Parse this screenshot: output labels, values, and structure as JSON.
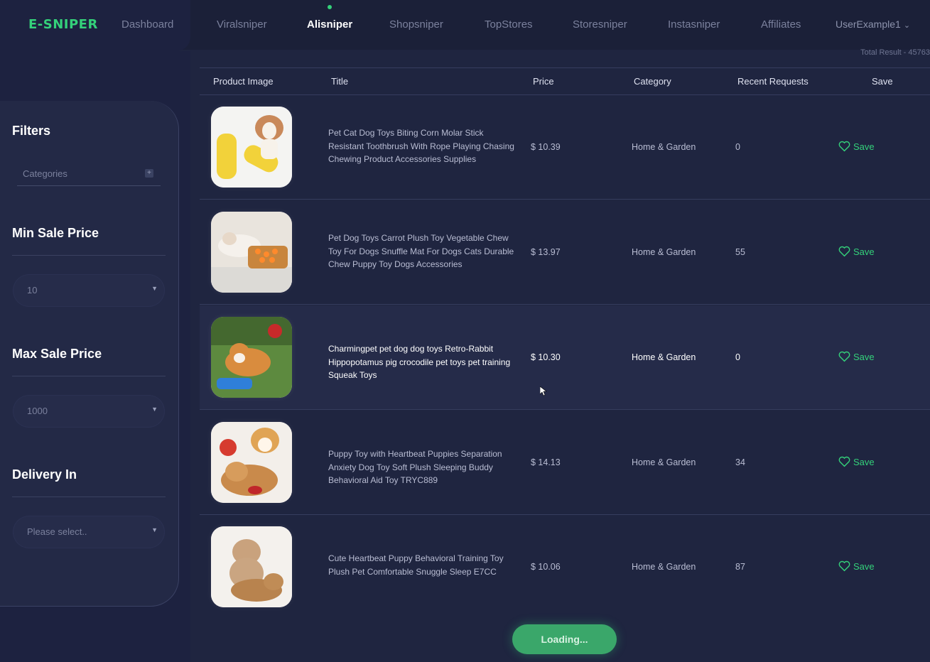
{
  "app": {
    "logo": "E-SNIPER"
  },
  "nav": {
    "items": [
      "Dashboard",
      "Viralsniper",
      "Alisniper",
      "Shopsniper",
      "TopStores",
      "Storesniper",
      "Instasniper",
      "Affiliates"
    ],
    "active": "Alisniper",
    "user": "UserExample1"
  },
  "sidebar": {
    "filters_heading": "Filters",
    "categories_label": "Categories",
    "min_sale_price": {
      "heading": "Min Sale Price",
      "value": "10"
    },
    "max_sale_price": {
      "heading": "Max Sale Price",
      "value": "1000"
    },
    "delivery_in": {
      "heading": "Delivery In",
      "placeholder": "Please select.."
    }
  },
  "table": {
    "total_result": "Total Result - 45763",
    "columns": [
      "Product Image",
      "Title",
      "Price",
      "Category",
      "Recent Requests",
      "Save"
    ],
    "rows": [
      {
        "title": "Pet Cat Dog Toys Biting Corn Molar Stick Resistant Toothbrush With Rope Playing Chasing Chewing Product Accessories Supplies",
        "price": "$ 10.39",
        "category": "Home & Garden",
        "requests": "0",
        "save": "Save"
      },
      {
        "title": "Pet Dog Toys Carrot Plush Toy Vegetable Chew Toy For Dogs Snuffle Mat For Dogs Cats Durable Chew Puppy Toy Dogs Accessories",
        "price": "$ 13.97",
        "category": "Home & Garden",
        "requests": "55",
        "save": "Save"
      },
      {
        "title": "Charmingpet pet dog dog toys Retro-Rabbit Hippopotamus pig crocodile pet toys pet training Squeak Toys",
        "price": "$ 10.30",
        "category": "Home & Garden",
        "requests": "0",
        "save": "Save"
      },
      {
        "title": "Puppy Toy with Heartbeat Puppies Separation Anxiety Dog Toy Soft Plush Sleeping Buddy Behavioral Aid Toy TRYC889",
        "price": "$ 14.13",
        "category": "Home & Garden",
        "requests": "34",
        "save": "Save"
      },
      {
        "title": "Cute Heartbeat Puppy Behavioral Training Toy Plush Pet Comfortable Snuggle Sleep E7CC",
        "price": "$ 10.06",
        "category": "Home & Garden",
        "requests": "87",
        "save": "Save"
      }
    ]
  },
  "loading_label": "Loading...",
  "colors": {
    "accent": "#34d17a",
    "background": "#1f2540",
    "sidebar": "#232946"
  }
}
